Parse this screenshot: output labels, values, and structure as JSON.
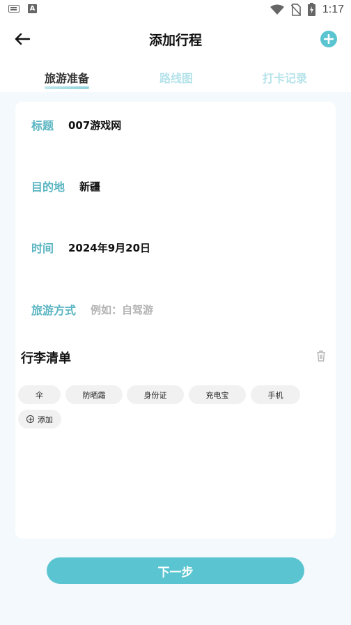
{
  "status_bar": {
    "time": "1:17",
    "a_badge": "A"
  },
  "header": {
    "title": "添加行程",
    "back_icon": "arrow-left-icon",
    "add_icon": "plus-circle-icon"
  },
  "tabs": [
    {
      "label": "旅游准备",
      "active": true
    },
    {
      "label": "路线图",
      "active": false
    },
    {
      "label": "打卡记录",
      "active": false
    }
  ],
  "form": {
    "title_label": "标题",
    "title_value": "007游戏网",
    "destination_label": "目的地",
    "destination_value": "新疆",
    "time_label": "时间",
    "time_value": "2024年9月20日",
    "mode_label": "旅游方式",
    "mode_placeholder": "例如：自驾游"
  },
  "luggage": {
    "title": "行李清单",
    "items": [
      "伞",
      "防晒霜",
      "身份证",
      "充电宝",
      "手机"
    ],
    "add_label": "添加"
  },
  "next_button": "下一步",
  "colors": {
    "accent": "#5ac5d1",
    "label": "#5bb5c2",
    "tab_inactive": "#b5e3ea",
    "background": "#f3f9fc"
  }
}
